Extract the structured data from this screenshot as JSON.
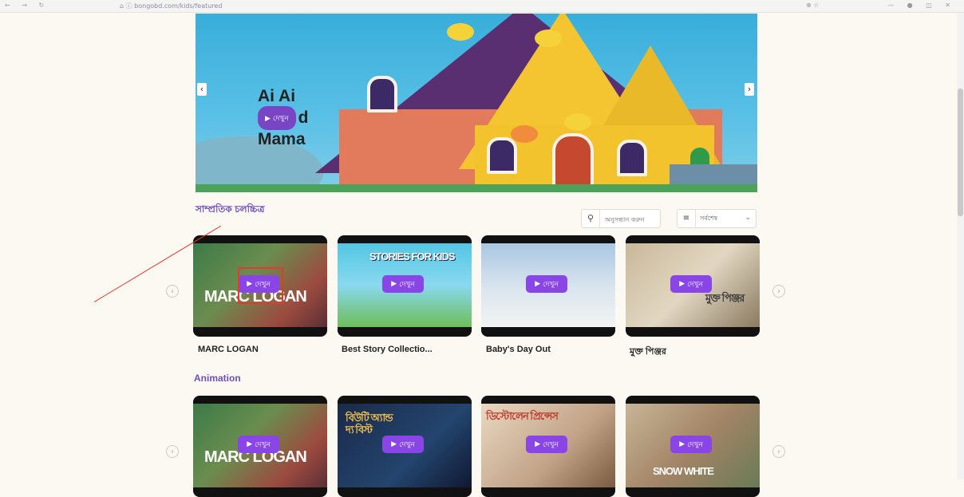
{
  "browser": {
    "nav_icons": "← → ↻",
    "url": "⌂ ⓘ bongobd.com/kids/featured",
    "zoom": "⊕ ☆",
    "window_controls": "— ● ◫ ✕"
  },
  "hero": {
    "title_line1": "Ai Ai",
    "title_line2_suffix": "d",
    "title_line3": "Mama",
    "play_label": "দেখুন",
    "prev_arrow": "‹",
    "next_arrow": "›"
  },
  "recent": {
    "title": "সাম্প্রতিক চলচ্চিত্র",
    "search_placeholder": "অনুসন্ধান করুন",
    "sort_label": "সর্বশেষ",
    "items": [
      {
        "title": "MARC LOGAN",
        "play_label": "দেখুন",
        "logo": "MARC LOGAN"
      },
      {
        "title": "Best Story Collectio...",
        "play_label": "দেখুন",
        "logo": "STORIES FOR KIDS"
      },
      {
        "title": "Baby's Day Out",
        "play_label": "দেখুন",
        "logo": ""
      },
      {
        "title": "মুক্ত পিঞ্জর",
        "play_label": "দেখুন",
        "logo": "মুক্ত পিঞ্জর"
      }
    ]
  },
  "animation": {
    "title": "Animation",
    "items": [
      {
        "play_label": "দেখুন",
        "logo": "MARC LOGAN"
      },
      {
        "play_label": "দেখুন",
        "logo": "বিউটি অ্যান্ড দ্য বিস্ট"
      },
      {
        "play_label": "দেখুন",
        "logo": "ডিস্টোলেন প্রিন্সেস"
      },
      {
        "play_label": "দেখুন",
        "logo": "SNOW WHITE"
      }
    ]
  },
  "icons": {
    "search": "search-icon",
    "sort": "sort-icon",
    "play": "play-icon",
    "chevron": "chevron-down-icon",
    "carousel_prev": "chevron-left-icon",
    "carousel_next": "chevron-right-icon"
  },
  "colors": {
    "accent": "#7a45c5",
    "play_button": "#8a45e6",
    "section_title": "#6f4fb4",
    "background": "#fbf9f1",
    "annotation": "#e23a2f"
  }
}
